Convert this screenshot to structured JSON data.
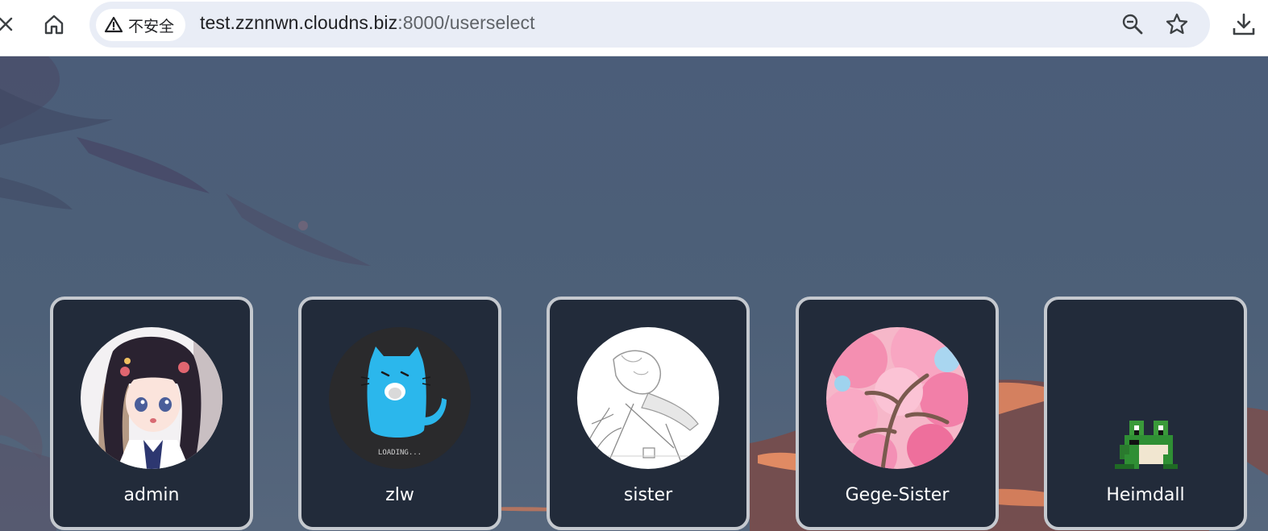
{
  "browser": {
    "security_label": "不安全",
    "url_host": "test.zznnwn.cloudns.biz",
    "url_rest": ":8000/userselect",
    "icons": {
      "close": "close-icon",
      "home": "home-icon",
      "warning": "warning-triangle-icon",
      "zoom": "zoom-out-icon",
      "bookmark": "star-icon",
      "download": "download-icon"
    }
  },
  "users": [
    {
      "name": "admin",
      "avatar": "anime-girl-avatar"
    },
    {
      "name": "zlw",
      "avatar": "blue-cat-loading-avatar",
      "avatar_text": "LOADING..."
    },
    {
      "name": "sister",
      "avatar": "sketch-avatar"
    },
    {
      "name": "Gege-Sister",
      "avatar": "cherry-blossom-avatar"
    },
    {
      "name": "Heimdall",
      "avatar": "pixel-frog-avatar"
    }
  ],
  "colors": {
    "card_bg": "#222b3a",
    "card_border": "#c5c9cf",
    "page_bg": "#4b5d79",
    "cloud_accent": "#d4805f"
  }
}
